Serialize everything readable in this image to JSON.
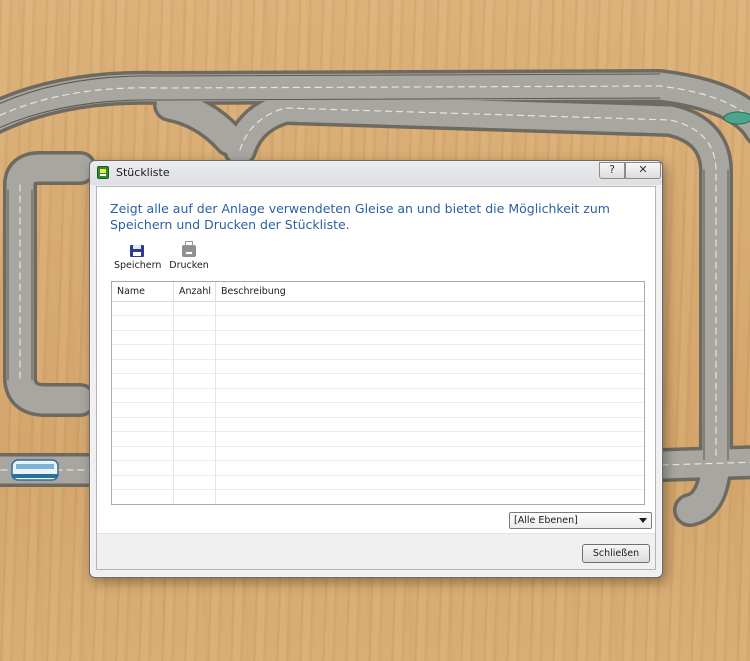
{
  "dialog": {
    "title": "Stückliste",
    "help_glyph": "?",
    "close_glyph": "✕",
    "description": "Zeigt alle auf der Anlage verwendeten Gleise an und bietet die Möglichkeit zum Speichern und Drucken der Stückliste.",
    "toolbar": {
      "save_label": "Speichern",
      "print_label": "Drucken",
      "save_icon": "floppy-disk-icon",
      "print_icon": "printer-icon"
    },
    "table": {
      "columns": [
        "Name",
        "Anzahl",
        "Beschreibung"
      ],
      "rows": []
    },
    "layer_select": {
      "selected": "[Alle Ebenen]"
    },
    "close_button_label": "Schließen"
  },
  "colors": {
    "heading": "#2a5fa5",
    "track_asphalt": "#9a9a96",
    "track_border": "#6e6a60",
    "wood": "#d8ab72"
  }
}
